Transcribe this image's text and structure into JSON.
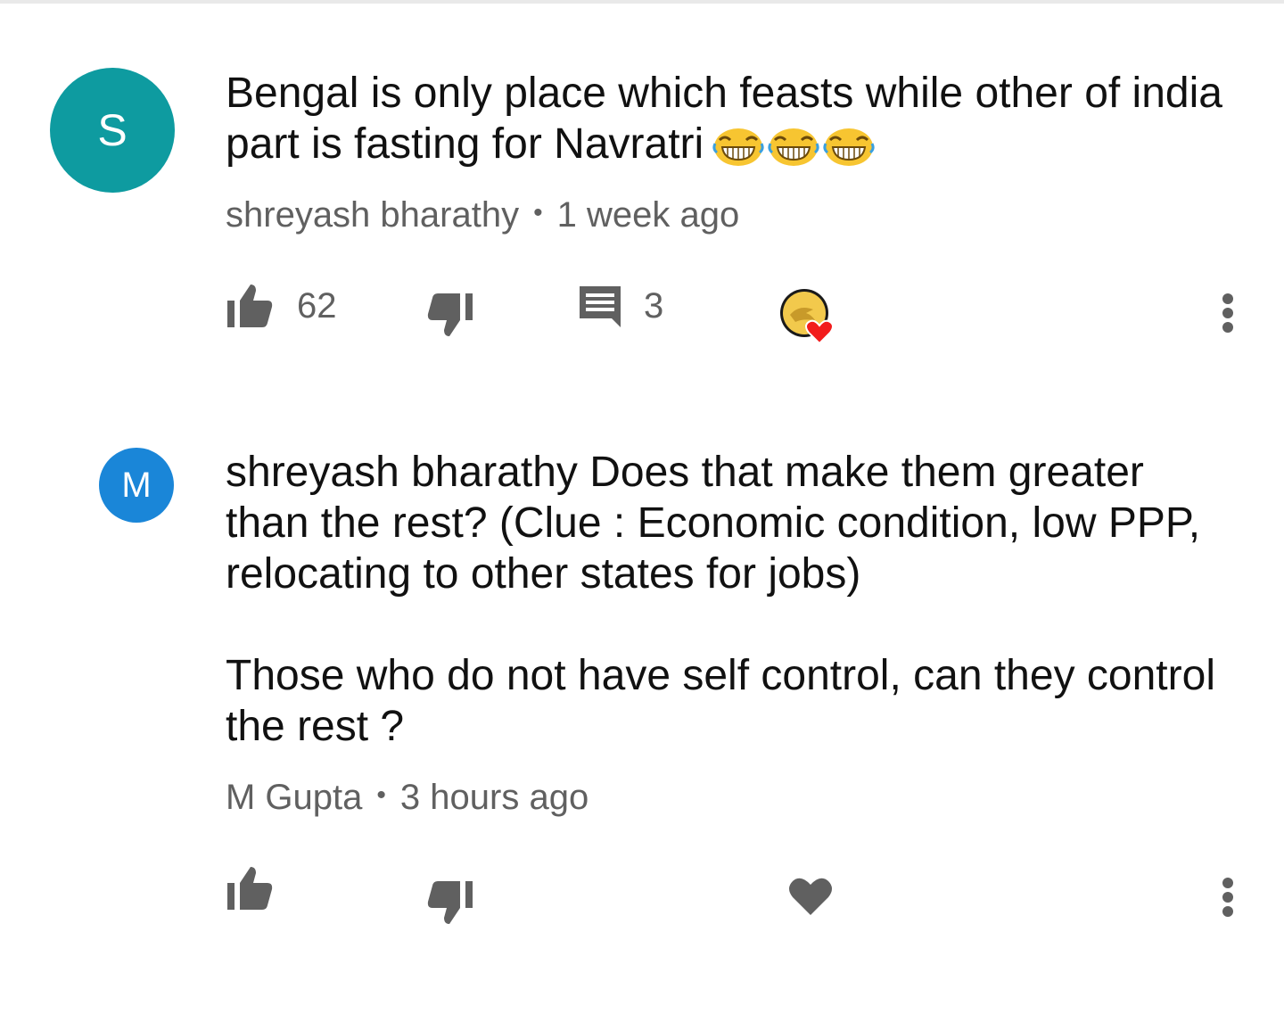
{
  "comments": [
    {
      "avatar_letter": "S",
      "avatar_color": "#0e9ba0",
      "text": "Bengal is only place which feasts while other of india part is fasting for Navratri",
      "emoji": [
        "tears-of-joy-emoji",
        "tears-of-joy-emoji",
        "tears-of-joy-emoji"
      ],
      "author": "shreyash bharathy",
      "separator": "•",
      "time": "1 week ago",
      "likes": "62",
      "replies": "3",
      "creator_hearted": true,
      "icons": {
        "like": "thumb-up-icon",
        "dislike": "thumb-down-icon",
        "reply": "comment-icon",
        "heart": "creator-heart-badge",
        "more": "more-vert-icon"
      }
    },
    {
      "avatar_letter": "M",
      "avatar_color": "#1a86d8",
      "text": "shreyash bharathy Does that make them greater than the rest? (Clue : Economic condition, low PPP, relocating to other states for jobs)\n\nThose who do not have self control, can they control the rest ?",
      "author": "M Gupta",
      "separator": "•",
      "time": "3 hours ago",
      "icons": {
        "like": "thumb-up-icon",
        "dislike": "thumb-down-icon",
        "heart": "heart-icon",
        "more": "more-vert-icon"
      }
    }
  ],
  "colors": {
    "icon_gray": "#606060",
    "text": "#111111",
    "meta": "#606060",
    "heart_red": "#f21c1c"
  }
}
